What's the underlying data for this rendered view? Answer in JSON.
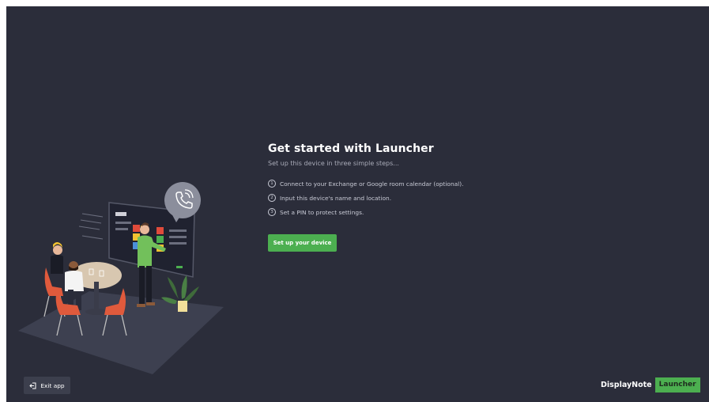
{
  "colors": {
    "background": "#2b2d3a",
    "accent": "#4caf50",
    "surface": "#3c3f4d",
    "text_primary": "#ffffff",
    "text_secondary": "#a9abb8"
  },
  "main": {
    "title": "Get started with Launcher",
    "subtitle": "Set up this device in three simple steps...",
    "steps": [
      {
        "number": "1",
        "text": "Connect to your Exchange or Google room calendar (optional)."
      },
      {
        "number": "2",
        "text": "Input this device's name and location."
      },
      {
        "number": "3",
        "text": "Set a PIN to protect settings."
      }
    ],
    "cta_label": "Set up your device"
  },
  "footer": {
    "exit_label": "Exit app",
    "exit_icon": "exit-icon",
    "brand_name": "DisplayNote",
    "brand_product": "Launcher"
  },
  "illustration": {
    "icon": "phone-call-icon"
  }
}
